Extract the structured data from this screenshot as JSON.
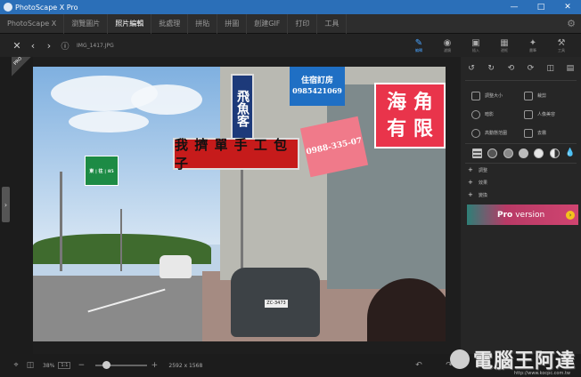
{
  "window": {
    "title": "PhotoScape X Pro"
  },
  "menu": {
    "items": [
      "PhotoScape X",
      "瀏覽圖片",
      "照片編輯",
      "批處理",
      "拼貼",
      "拼圖",
      "創建GIF",
      "打印",
      "工具"
    ],
    "active_index": 2
  },
  "toolbar": {
    "filename": "IMG_1417.JPG"
  },
  "panel_tabs": [
    {
      "label": "編輯",
      "icon": "edit-icon"
    },
    {
      "label": "濾鏡",
      "icon": "filter-icon"
    },
    {
      "label": "插入",
      "icon": "insert-icon"
    },
    {
      "label": "邊框",
      "icon": "frame-icon"
    },
    {
      "label": "畫筆",
      "icon": "brush-icon"
    },
    {
      "label": "工具",
      "icon": "tools-icon"
    }
  ],
  "photo": {
    "sign_red": "我 擠 單 手 工 包 子",
    "sign_blue_top": "住宿訂房",
    "sign_blue_phone": "0985421069",
    "sign_vertical": "飛魚客",
    "sign_pink_line1": "海 角",
    "sign_pink_line2": "有 限",
    "sign_mid": "0988-335-07",
    "sign_green": "東  |  往  | 85",
    "plate": "ZC-3473",
    "pro_badge": "PRO"
  },
  "tools": [
    {
      "label": "調整大小",
      "icon": "resize-icon"
    },
    {
      "label": "裁剪",
      "icon": "crop-icon"
    },
    {
      "label": "暗影",
      "icon": "vignette-icon"
    },
    {
      "label": "人像美容",
      "icon": "portrait-icon"
    },
    {
      "label": "高動態范圍",
      "icon": "hdr-icon"
    },
    {
      "label": "去霧",
      "icon": "dehaze-icon"
    }
  ],
  "accordion": [
    "調整",
    "效果",
    "變換"
  ],
  "promo": {
    "brand": "Pro",
    "text": "version"
  },
  "status": {
    "zoom": "38%",
    "fit": "1:1",
    "dimensions": "2592 x 1568"
  },
  "watermark": {
    "text": "電腦王阿達",
    "url": "http://www.kocpc.com.tw"
  }
}
